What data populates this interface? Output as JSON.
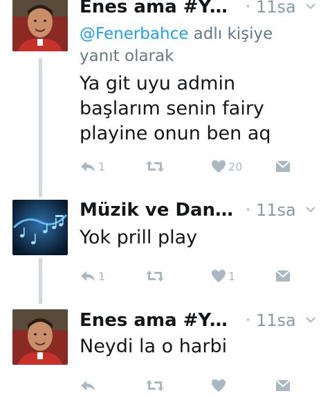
{
  "thread": {
    "tweets": [
      {
        "name": "Enes ama #Ye...",
        "time": "11sa",
        "dot": "·",
        "reply_handle": "@Fenerbahce",
        "reply_suffix": " adlı kişiye yanıt olarak",
        "text": "Ya git uyu admin başlarım senin fairy playine onun ben aq",
        "reply_count": "1",
        "retweet_count": "",
        "like_count": "20",
        "avatar_icon": "enes-avatar-icon"
      },
      {
        "name": "Müzik ve Dans ...",
        "time": "11sa",
        "dot": "·",
        "text": "Yok prill play",
        "reply_count": "1",
        "retweet_count": "",
        "like_count": "1",
        "avatar_icon": "music-notes-avatar-icon"
      },
      {
        "name": "Enes ama #Ye...",
        "time": "11sa",
        "dot": "·",
        "text": "Neydi la o harbi",
        "reply_count": "",
        "retweet_count": "",
        "like_count": "",
        "avatar_icon": "enes-avatar-icon"
      }
    ]
  },
  "colors": {
    "link": "#1da1f2",
    "muted": "#8899a6",
    "icon": "#aab8c2",
    "thread_line": "#cfd9de"
  }
}
